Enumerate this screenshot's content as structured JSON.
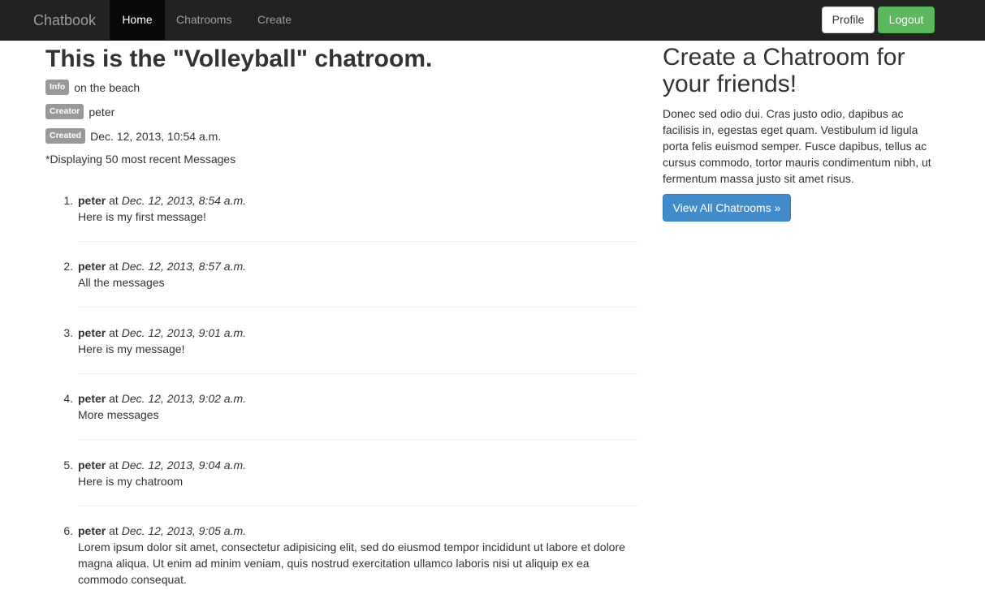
{
  "navbar": {
    "brand": "Chatbook",
    "links": [
      "Home",
      "Chatrooms",
      "Create"
    ],
    "profile_label": "Profile",
    "logout_label": "Logout"
  },
  "room": {
    "title_prefix": "This is the \"",
    "title_name": "Volleyball",
    "title_suffix": "\" chatroom.",
    "info_label": "Info",
    "info_value": "on the beach",
    "creator_label": "Creator",
    "creator_value": "peter",
    "created_label": "Created",
    "created_value": "Dec. 12, 2013, 10:54 a.m.",
    "displaying_note": "*Displaying 50 most recent Messages"
  },
  "messages": [
    {
      "num": "1.",
      "author": "peter",
      "at": "at",
      "time": "Dec. 12, 2013, 8:54 a.m.",
      "text": "Here is my first message!"
    },
    {
      "num": "2.",
      "author": "peter",
      "at": "at",
      "time": "Dec. 12, 2013, 8:57 a.m.",
      "text": "All the messages"
    },
    {
      "num": "3.",
      "author": "peter",
      "at": "at",
      "time": "Dec. 12, 2013, 9:01 a.m.",
      "text": "Here is my message!"
    },
    {
      "num": "4.",
      "author": "peter",
      "at": "at",
      "time": "Dec. 12, 2013, 9:02 a.m.",
      "text": "More messages"
    },
    {
      "num": "5.",
      "author": "peter",
      "at": "at",
      "time": "Dec. 12, 2013, 9:04 a.m.",
      "text": "Here is my chatroom"
    },
    {
      "num": "6.",
      "author": "peter",
      "at": "at",
      "time": "Dec. 12, 2013, 9:05 a.m.",
      "text": "Lorem ipsum dolor sit amet, consectetur adipisicing elit, sed do eiusmod tempor incididunt ut labore et dolore magna aliqua. Ut enim ad minim veniam, quis nostrud exercitation ullamco laboris nisi ut aliquip ex ea commodo consequat."
    }
  ],
  "sidebar": {
    "heading": "Create a Chatroom for your friends!",
    "text": "Donec sed odio dui. Cras justo odio, dapibus ac facilisis in, egestas eget quam. Vestibulum id ligula porta felis euismod semper. Fusce dapibus, tellus ac cursus commodo, tortor mauris condimentum nibh, ut fermentum massa justo sit amet risus.",
    "button_label": "View All Chatrooms »"
  },
  "colors": {
    "navbar_bg": "#222222",
    "logout_green": "#5cb85c",
    "primary_blue": "#428bca",
    "label_gray": "#999999"
  }
}
